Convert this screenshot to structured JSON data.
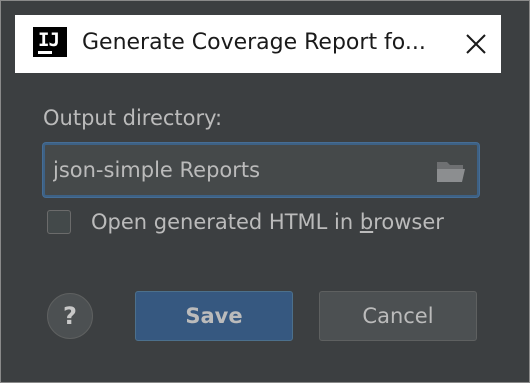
{
  "window": {
    "title": "Generate Coverage Report fo...",
    "app_icon_text": "IJ",
    "close_glyph": "✕"
  },
  "form": {
    "output_label": "Output directory:",
    "output_value": "json-simple Reports",
    "checkbox_label_before": "Open generated HTML in ",
    "checkbox_label_mnemonic": "b",
    "checkbox_label_after": "rowser",
    "checkbox_checked": false
  },
  "buttons": {
    "help": "?",
    "save": "Save",
    "cancel": "Cancel"
  },
  "icons": {
    "app": "intellij-icon",
    "close": "close-icon",
    "folder": "folder-icon",
    "help": "help-icon"
  },
  "colors": {
    "dialog_bg": "#3c3f41",
    "titlebar_bg": "#ffffff",
    "input_focus_border": "#3d6185",
    "primary_button": "#365880",
    "text": "#bbbbbb"
  }
}
